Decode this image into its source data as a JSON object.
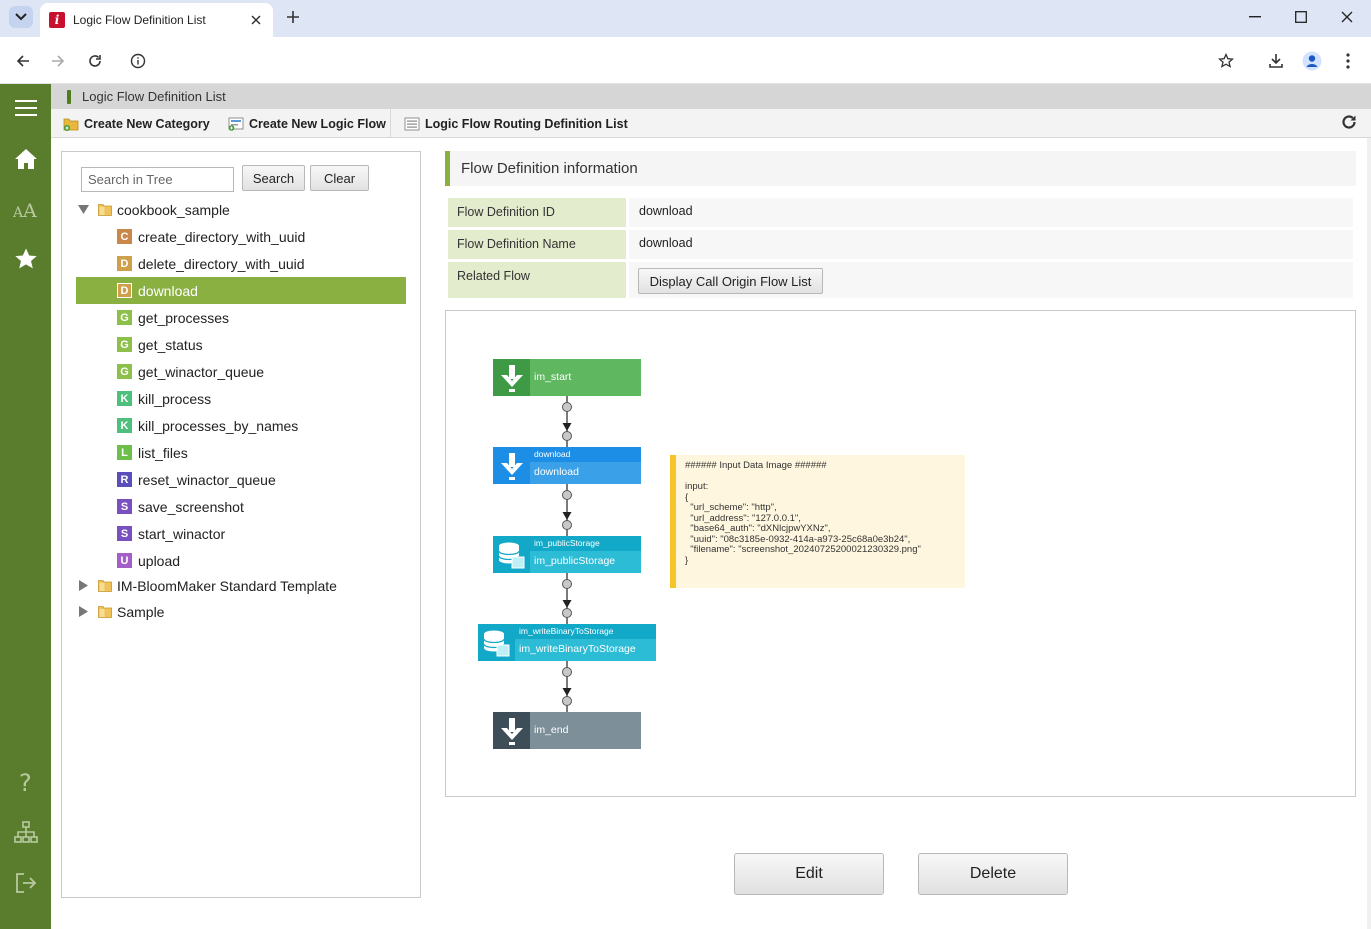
{
  "browser": {
    "tab_title": "Logic Flow Definition List"
  },
  "app": {
    "title": "Logic Flow Definition List",
    "menu": {
      "create_category": "Create New Category",
      "create_flow": "Create New Logic Flow",
      "routing_list": "Logic Flow Routing Definition List"
    },
    "sidebar": [
      "menu-icon",
      "home-icon",
      "font-icon",
      "star-icon",
      "help-icon",
      "sitemap-icon",
      "logout-icon"
    ]
  },
  "tree": {
    "search_placeholder": "Search in Tree",
    "search_label": "Search",
    "clear_label": "Clear",
    "root_open": "cookbook_sample",
    "items": [
      {
        "letter": "C",
        "label": "create_directory_with_uuid",
        "color": "#c9884a"
      },
      {
        "letter": "D",
        "label": "delete_directory_with_uuid",
        "color": "#cfa04b"
      },
      {
        "letter": "D",
        "label": "download",
        "color": "#cfa04b",
        "selected": true
      },
      {
        "letter": "G",
        "label": "get_processes",
        "color": "#8cc04a"
      },
      {
        "letter": "G",
        "label": "get_status",
        "color": "#8cc04a"
      },
      {
        "letter": "G",
        "label": "get_winactor_queue",
        "color": "#8cc04a"
      },
      {
        "letter": "K",
        "label": "kill_process",
        "color": "#4fbf7d"
      },
      {
        "letter": "K",
        "label": "kill_processes_by_names",
        "color": "#4fbf7d"
      },
      {
        "letter": "L",
        "label": "list_files",
        "color": "#6cc04a"
      },
      {
        "letter": "R",
        "label": "reset_winactor_queue",
        "color": "#5a4fb8"
      },
      {
        "letter": "S",
        "label": "save_screenshot",
        "color": "#7a4fc0"
      },
      {
        "letter": "S",
        "label": "start_winactor",
        "color": "#7a4fc0"
      },
      {
        "letter": "U",
        "label": "upload",
        "color": "#a35fc7"
      }
    ],
    "root_closed": [
      "IM-BloomMaker Standard Template",
      "Sample"
    ]
  },
  "detail": {
    "header": "Flow Definition information",
    "id_label": "Flow Definition ID",
    "id_value": "download",
    "name_label": "Flow Definition Name",
    "name_value": "download",
    "related_label": "Related Flow",
    "related_button": "Display Call Origin Flow List"
  },
  "flow": {
    "nodes": [
      {
        "kind": "start",
        "top_label": "",
        "label": "im_start",
        "color": "#5fb760",
        "icon_color": "#3f9a45"
      },
      {
        "kind": "task",
        "top_label": "download",
        "label": "download",
        "color": "#3aa0e8",
        "icon_color": "#1d8ee6"
      },
      {
        "kind": "task",
        "top_label": "im_publicStorage",
        "label": "im_publicStorage",
        "color": "#2cbcd6",
        "icon_color": "#12a9c8"
      },
      {
        "kind": "task",
        "top_label": "im_writeBinaryToStorage",
        "label": "im_writeBinaryToStorage",
        "color": "#2cbcd6",
        "icon_color": "#12a9c8"
      },
      {
        "kind": "end",
        "top_label": "",
        "label": "im_end",
        "color": "#7d8f99",
        "icon_color": "#3d4e58"
      }
    ],
    "note_lines": [
      "###### Input Data Image ######",
      "",
      "input:",
      "{",
      "  \"url_scheme\": \"http\",",
      "  \"url_address\": \"127.0.0.1\",",
      "  \"base64_auth\": \"dXNlcjpwYXNz\",",
      "  \"uuid\": \"08c3185e-0932-414a-a973-25c68a0e3b24\",",
      "  \"filename\": \"screenshot_20240725200021230329.png\"",
      "}"
    ]
  },
  "actions": {
    "edit": "Edit",
    "delete": "Delete"
  },
  "colors": {
    "sidebar": "#5a7d2d",
    "selected": "#8ab042",
    "label_bg": "#e3eccd"
  }
}
